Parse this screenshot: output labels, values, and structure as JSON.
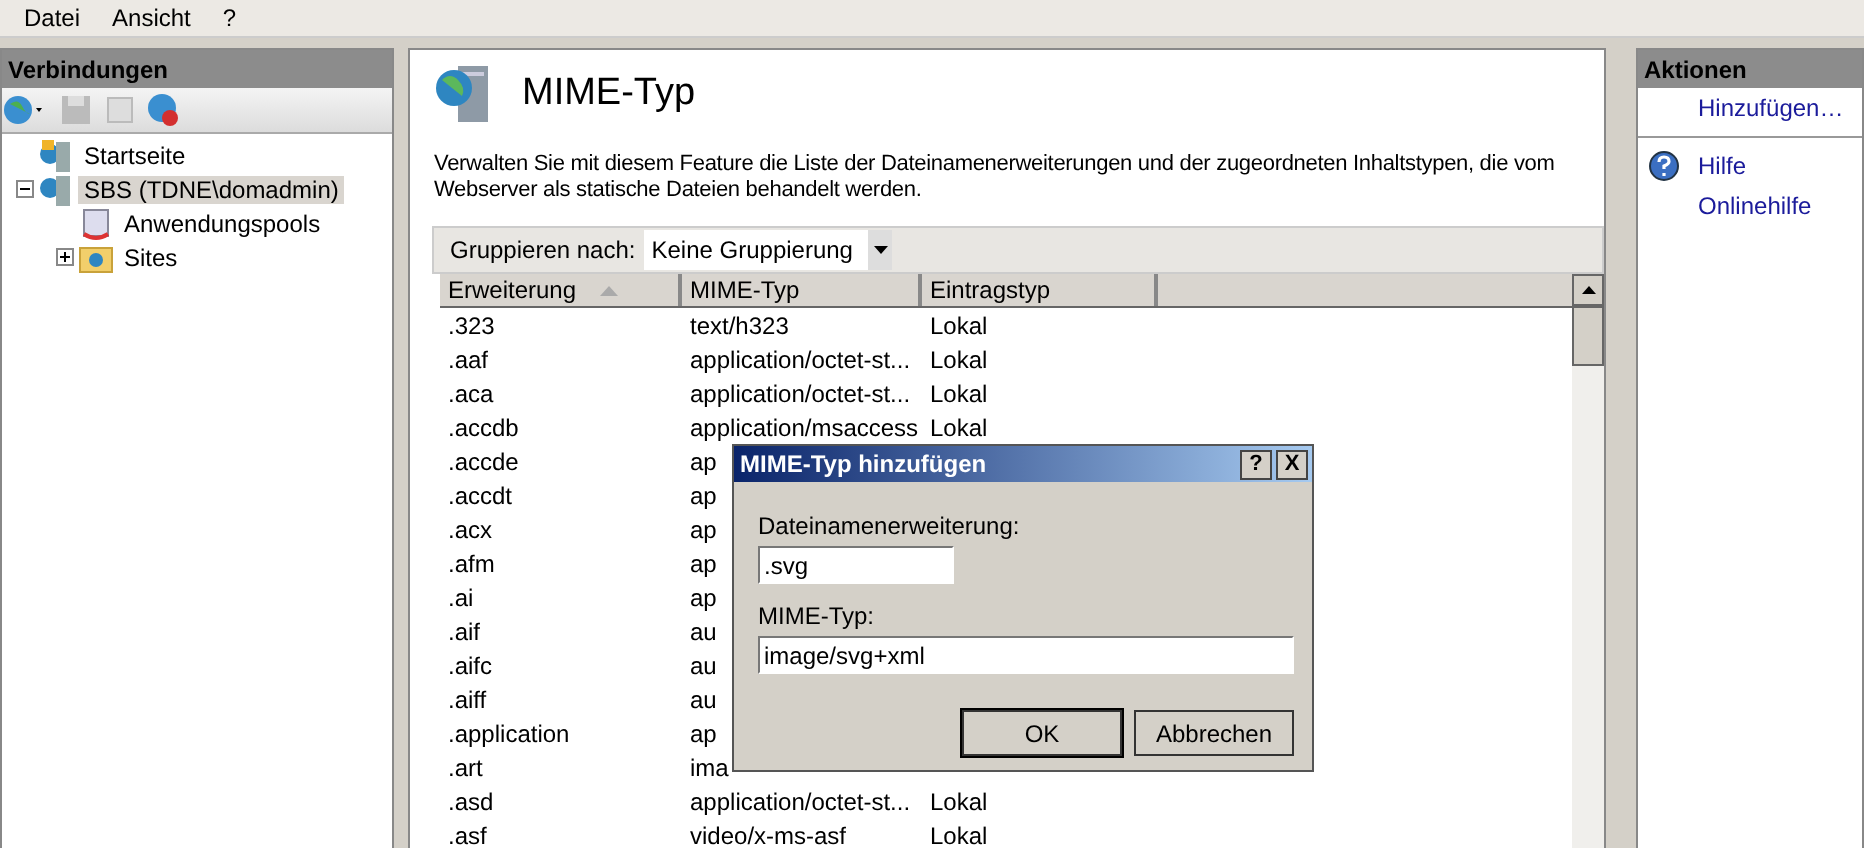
{
  "menu": [
    "Datei",
    "Ansicht",
    "?"
  ],
  "connections": {
    "title": "Verbindungen",
    "tree": [
      {
        "label": "Startseite",
        "kind": "home",
        "selected": false
      },
      {
        "label": "SBS (TDNE\\domadmin)",
        "kind": "server",
        "selected": true,
        "expanded": true,
        "children": [
          {
            "label": "Anwendungspools",
            "kind": "pool",
            "selected": false
          },
          {
            "label": "Sites",
            "kind": "sites",
            "selected": false,
            "expanded": false
          }
        ]
      }
    ]
  },
  "main": {
    "title": "MIME-Typ",
    "description": "Verwalten Sie mit diesem Feature die Liste der Dateinamenerweiterungen und der zugeordneten Inhaltstypen, die vom Webserver als statische Dateien behandelt werden.",
    "group_label": "Gruppieren nach:",
    "group_value": "Keine Gruppierung",
    "columns": [
      "Erweiterung",
      "MIME-Typ",
      "Eintragstyp"
    ],
    "rows": [
      {
        "ext": ".323",
        "mime": "text/h323",
        "type": "Lokal"
      },
      {
        "ext": ".aaf",
        "mime": "application/octet-st...",
        "type": "Lokal"
      },
      {
        "ext": ".aca",
        "mime": "application/octet-st...",
        "type": "Lokal"
      },
      {
        "ext": ".accdb",
        "mime": "application/msaccess",
        "type": "Lokal"
      },
      {
        "ext": ".accde",
        "mime": "ap"
      },
      {
        "ext": ".accdt",
        "mime": "ap"
      },
      {
        "ext": ".acx",
        "mime": "ap"
      },
      {
        "ext": ".afm",
        "mime": "ap"
      },
      {
        "ext": ".ai",
        "mime": "ap"
      },
      {
        "ext": ".aif",
        "mime": "au"
      },
      {
        "ext": ".aifc",
        "mime": "au"
      },
      {
        "ext": ".aiff",
        "mime": "au"
      },
      {
        "ext": ".application",
        "mime": "ap"
      },
      {
        "ext": ".art",
        "mime": "ima"
      },
      {
        "ext": ".asd",
        "mime": "application/octet-st...",
        "type": "Lokal"
      },
      {
        "ext": ".asf",
        "mime": "video/x-ms-asf",
        "type": "Lokal"
      }
    ]
  },
  "actions": {
    "title": "Aktionen",
    "items": [
      {
        "label": "Hinzufügen…",
        "kind": "link"
      },
      {
        "kind": "divider"
      },
      {
        "label": "Hilfe",
        "kind": "help"
      },
      {
        "label": "Onlinehilfe",
        "kind": "link"
      }
    ]
  },
  "dialog": {
    "title": "MIME-Typ hinzufügen",
    "help_button": "?",
    "close_button": "X",
    "ext_label": "Dateinamenerweiterung:",
    "ext_value": ".svg",
    "mime_label": "MIME-Typ:",
    "mime_value": "image/svg+xml",
    "buttons": [
      "OK",
      "Abbrechen"
    ]
  }
}
